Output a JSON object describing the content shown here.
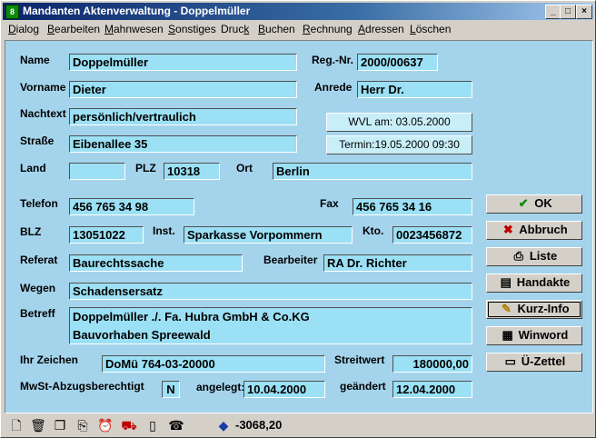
{
  "window": {
    "title": "Mandanten Aktenverwaltung - Doppelmüller",
    "app_icon_letter": "8"
  },
  "menu": [
    {
      "label": "Dialog",
      "u": "D",
      "rest": "ialog"
    },
    {
      "label": "Bearbeiten",
      "u": "B",
      "rest": "earbeiten"
    },
    {
      "label": "Mahnwesen",
      "u": "M",
      "rest": "ahnwesen"
    },
    {
      "label": "Sonstiges",
      "u": "S",
      "rest": "onstiges"
    },
    {
      "label": "Druck",
      "pre": "Druc",
      "u": "k",
      "rest": ""
    },
    {
      "label": "Buchen",
      "u": "B",
      "rest": "uchen"
    },
    {
      "label": "Rechnung",
      "u": "R",
      "rest": "echnung"
    },
    {
      "label": "Adressen",
      "u": "A",
      "rest": "dressen"
    },
    {
      "label": "Löschen",
      "u": "L",
      "rest": "öschen"
    }
  ],
  "labels": {
    "name": "Name",
    "regnr": "Reg.-Nr.",
    "vorname": "Vorname",
    "anrede": "Anrede",
    "nachtext": "Nachtext",
    "strasse": "Straße",
    "land": "Land",
    "plz": "PLZ",
    "ort": "Ort",
    "telefon": "Telefon",
    "fax": "Fax",
    "blz": "BLZ",
    "inst": "Inst.",
    "kto": "Kto.",
    "referat": "Referat",
    "bearbeiter": "Bearbeiter",
    "wegen": "Wegen",
    "betreff": "Betreff",
    "ihr_zeichen": "Ihr Zeichen",
    "streitwert": "Streitwert",
    "mwst": "MwSt-Abzugsberechtigt",
    "angelegt": "angelegt:",
    "geaendert": "geändert"
  },
  "fields": {
    "name": "Doppelmüller",
    "regnr": "2000/00637",
    "vorname": "Dieter",
    "anrede": "Herr Dr.",
    "nachtext": "persönlich/vertraulich",
    "strasse": "Eibenallee 35",
    "land": "",
    "plz": "10318",
    "ort": "Berlin",
    "telefon": "456 765 34 98",
    "fax": "456 765 34 16",
    "blz": "13051022",
    "inst": "Sparkasse Vorpommern",
    "kto": "0023456872",
    "referat": "Baurechtssache",
    "bearbeiter": "RA Dr. Richter",
    "wegen": "Schadensersatz",
    "betreff_1": "Doppelmüller ./. Fa. Hubra GmbH & Co.KG",
    "betreff_2": "Bauvorhaben Spreewald",
    "ihr_zeichen": "DoMü 764-03-20000",
    "streitwert": "180000,00",
    "mwst": "N",
    "angelegt": "10.04.2000",
    "geaendert": "12.04.2000"
  },
  "info": {
    "wvl": "WVL am: 03.05.2000",
    "termin": "Termin:19.05.2000 09:30"
  },
  "buttons": {
    "ok": "OK",
    "abbruch": "Abbruch",
    "liste": "Liste",
    "handakte": "Handakte",
    "kurzinfo": "Kurz-Info",
    "winword": "Winword",
    "uezettel": "Ü-Zettel"
  },
  "status": {
    "balance": "-3068,20"
  },
  "colors": {
    "client_bg": "#a4d4ec",
    "field_bg": "#9be0f4",
    "title_start": "#0a246a"
  }
}
